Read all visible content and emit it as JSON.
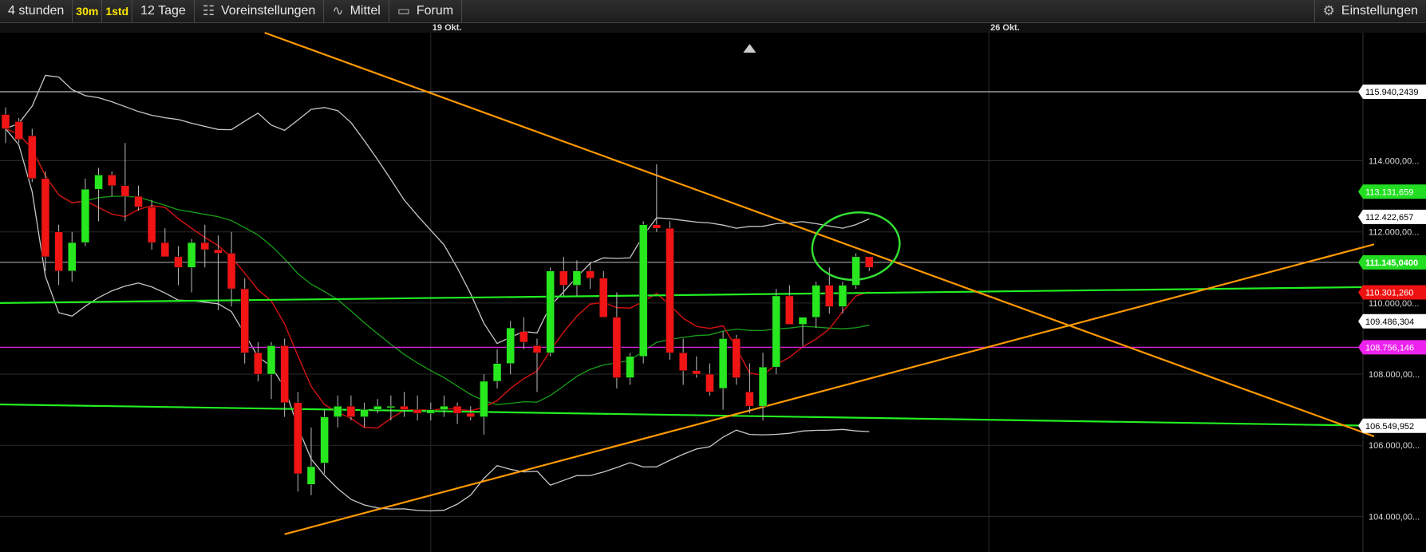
{
  "toolbar": {
    "timeframe": "4 stunden",
    "interval_30m": "30m",
    "interval_1std": "1std",
    "range": "12 Tage",
    "presets": "Voreinstellungen",
    "mean": "Mittel",
    "forum": "Forum",
    "settings": "Einstellungen",
    "icons": {
      "presets": "sliders-icon",
      "mean": "wave-icon",
      "forum": "chat-icon",
      "settings": "gear-icon"
    }
  },
  "chart_data": {
    "type": "candlestick",
    "date_labels": [
      {
        "label": "19 Okt.",
        "index": 32
      },
      {
        "label": "26 Okt.",
        "index": 74
      }
    ],
    "ylim": [
      103000,
      117600
    ],
    "y_ticks": [
      {
        "value": 114000,
        "label": "114.000,00..."
      },
      {
        "value": 112000,
        "label": "112.000,00..."
      },
      {
        "value": 110000,
        "label": "110.000,00..."
      },
      {
        "value": 108000,
        "label": "108.000,00..."
      },
      {
        "value": 106000,
        "label": "106.000,00..."
      },
      {
        "value": 104000,
        "label": "104.000,00..."
      }
    ],
    "price_tags": [
      {
        "value": 115940,
        "label": "115.940,2439",
        "bg": "#ffffff",
        "fg": "#000000"
      },
      {
        "value": 113131,
        "label": "113.131,659",
        "bg": "#22dd22",
        "fg": "#ffffff"
      },
      {
        "value": 112422,
        "label": "112.422,657",
        "bg": "#ffffff",
        "fg": "#000000"
      },
      {
        "value": 111145,
        "label": "111.145,0400",
        "bg": "#22dd22",
        "fg": "#ffffff",
        "bold": true
      },
      {
        "value": 110301,
        "label": "110.301,260",
        "bg": "#ee1111",
        "fg": "#ffffff"
      },
      {
        "value": 109486,
        "label": "109.486,304",
        "bg": "#ffffff",
        "fg": "#000000"
      },
      {
        "value": 108756,
        "label": "108.756,146",
        "bg": "#ee22ee",
        "fg": "#ffffff"
      },
      {
        "value": 106549,
        "label": "106.549,952",
        "bg": "#ffffff",
        "fg": "#000000"
      }
    ],
    "horizontal_lines": [
      {
        "value": 115940,
        "color": "#bbbbbb"
      },
      {
        "value": 111145,
        "color": "#888888"
      },
      {
        "value": 108756,
        "color": "#dd22dd"
      }
    ],
    "trend_lines": [
      {
        "from": [
          -0.5,
          110000
        ],
        "to": [
          103,
          110450
        ],
        "color": "#22ee22"
      },
      {
        "from": [
          -0.5,
          107150
        ],
        "to": [
          103,
          106549
        ],
        "color": "#22ee22"
      },
      {
        "from": [
          19.5,
          117600
        ],
        "to": [
          103,
          106250
        ],
        "color": "#ff9900"
      },
      {
        "from": [
          21,
          103500
        ],
        "to": [
          103,
          111650
        ],
        "color": "#ff9900"
      }
    ],
    "candles": [
      [
        115300,
        115500,
        114500,
        114900
      ],
      [
        115100,
        115200,
        114500,
        114600
      ],
      [
        114700,
        114900,
        113400,
        113500
      ],
      [
        113500,
        113700,
        110900,
        111300
      ],
      [
        112000,
        112200,
        110500,
        110900
      ],
      [
        110900,
        112000,
        110600,
        111700
      ],
      [
        111700,
        113500,
        111600,
        113200
      ],
      [
        113200,
        113800,
        112300,
        113600
      ],
      [
        113600,
        113700,
        113000,
        113300
      ],
      [
        113300,
        114500,
        112300,
        113000
      ],
      [
        113000,
        113300,
        112600,
        112700
      ],
      [
        112700,
        112900,
        111500,
        111700
      ],
      [
        111700,
        112100,
        111400,
        111300
      ],
      [
        111300,
        111600,
        110500,
        111000
      ],
      [
        111000,
        111800,
        110300,
        111700
      ],
      [
        111700,
        112200,
        111000,
        111500
      ],
      [
        111500,
        111900,
        109800,
        111400
      ],
      [
        111400,
        112000,
        109900,
        110400
      ],
      [
        110400,
        110700,
        108300,
        108600
      ],
      [
        108600,
        108900,
        107800,
        108000
      ],
      [
        108000,
        108900,
        107300,
        108800
      ],
      [
        108800,
        109000,
        106800,
        107200
      ],
      [
        107200,
        107500,
        104700,
        105200
      ],
      [
        104900,
        106500,
        104600,
        105400
      ],
      [
        105500,
        107000,
        105200,
        106800
      ],
      [
        106800,
        107400,
        106500,
        107100
      ],
      [
        107100,
        107400,
        106700,
        106800
      ],
      [
        106800,
        107200,
        106500,
        107000
      ],
      [
        107000,
        107300,
        106900,
        107100
      ],
      [
        107100,
        107400,
        106700,
        107100
      ],
      [
        107100,
        107500,
        106800,
        107000
      ],
      [
        107000,
        107400,
        106700,
        106900
      ],
      [
        106900,
        107200,
        106700,
        107000
      ],
      [
        107000,
        107400,
        106800,
        107100
      ],
      [
        107100,
        107200,
        106600,
        106900
      ],
      [
        106900,
        107100,
        106700,
        106800
      ],
      [
        106800,
        108000,
        106300,
        107800
      ],
      [
        107800,
        108700,
        107600,
        108300
      ],
      [
        108300,
        109500,
        108000,
        109300
      ],
      [
        109200,
        109600,
        108700,
        108900
      ],
      [
        108800,
        109000,
        107500,
        108600
      ],
      [
        108600,
        111000,
        108500,
        110900
      ],
      [
        110900,
        111300,
        110200,
        110500
      ],
      [
        110500,
        111200,
        110200,
        110900
      ],
      [
        110900,
        111100,
        110400,
        110700
      ],
      [
        110700,
        110900,
        109600,
        109600
      ],
      [
        109600,
        110300,
        107600,
        107900
      ],
      [
        107900,
        108600,
        107700,
        108500
      ],
      [
        108500,
        112300,
        108300,
        112200
      ],
      [
        112200,
        113900,
        112000,
        112100
      ],
      [
        112100,
        112300,
        108400,
        108600
      ],
      [
        108600,
        109000,
        107700,
        108100
      ],
      [
        108100,
        108500,
        107900,
        108000
      ],
      [
        108000,
        108300,
        107400,
        107500
      ],
      [
        107600,
        109200,
        107000,
        109000
      ],
      [
        109000,
        109100,
        107700,
        107900
      ],
      [
        107500,
        108300,
        106900,
        107100
      ],
      [
        107100,
        108600,
        106700,
        108200
      ],
      [
        108200,
        110400,
        108000,
        110200
      ],
      [
        110200,
        110500,
        109400,
        109400
      ],
      [
        109400,
        109600,
        108800,
        109600
      ],
      [
        109600,
        110600,
        109300,
        110500
      ],
      [
        110500,
        111000,
        109700,
        109900
      ],
      [
        109900,
        110600,
        109700,
        110500
      ],
      [
        110500,
        111400,
        110400,
        111300
      ],
      [
        111300,
        111300,
        110900,
        111000
      ]
    ]
  }
}
